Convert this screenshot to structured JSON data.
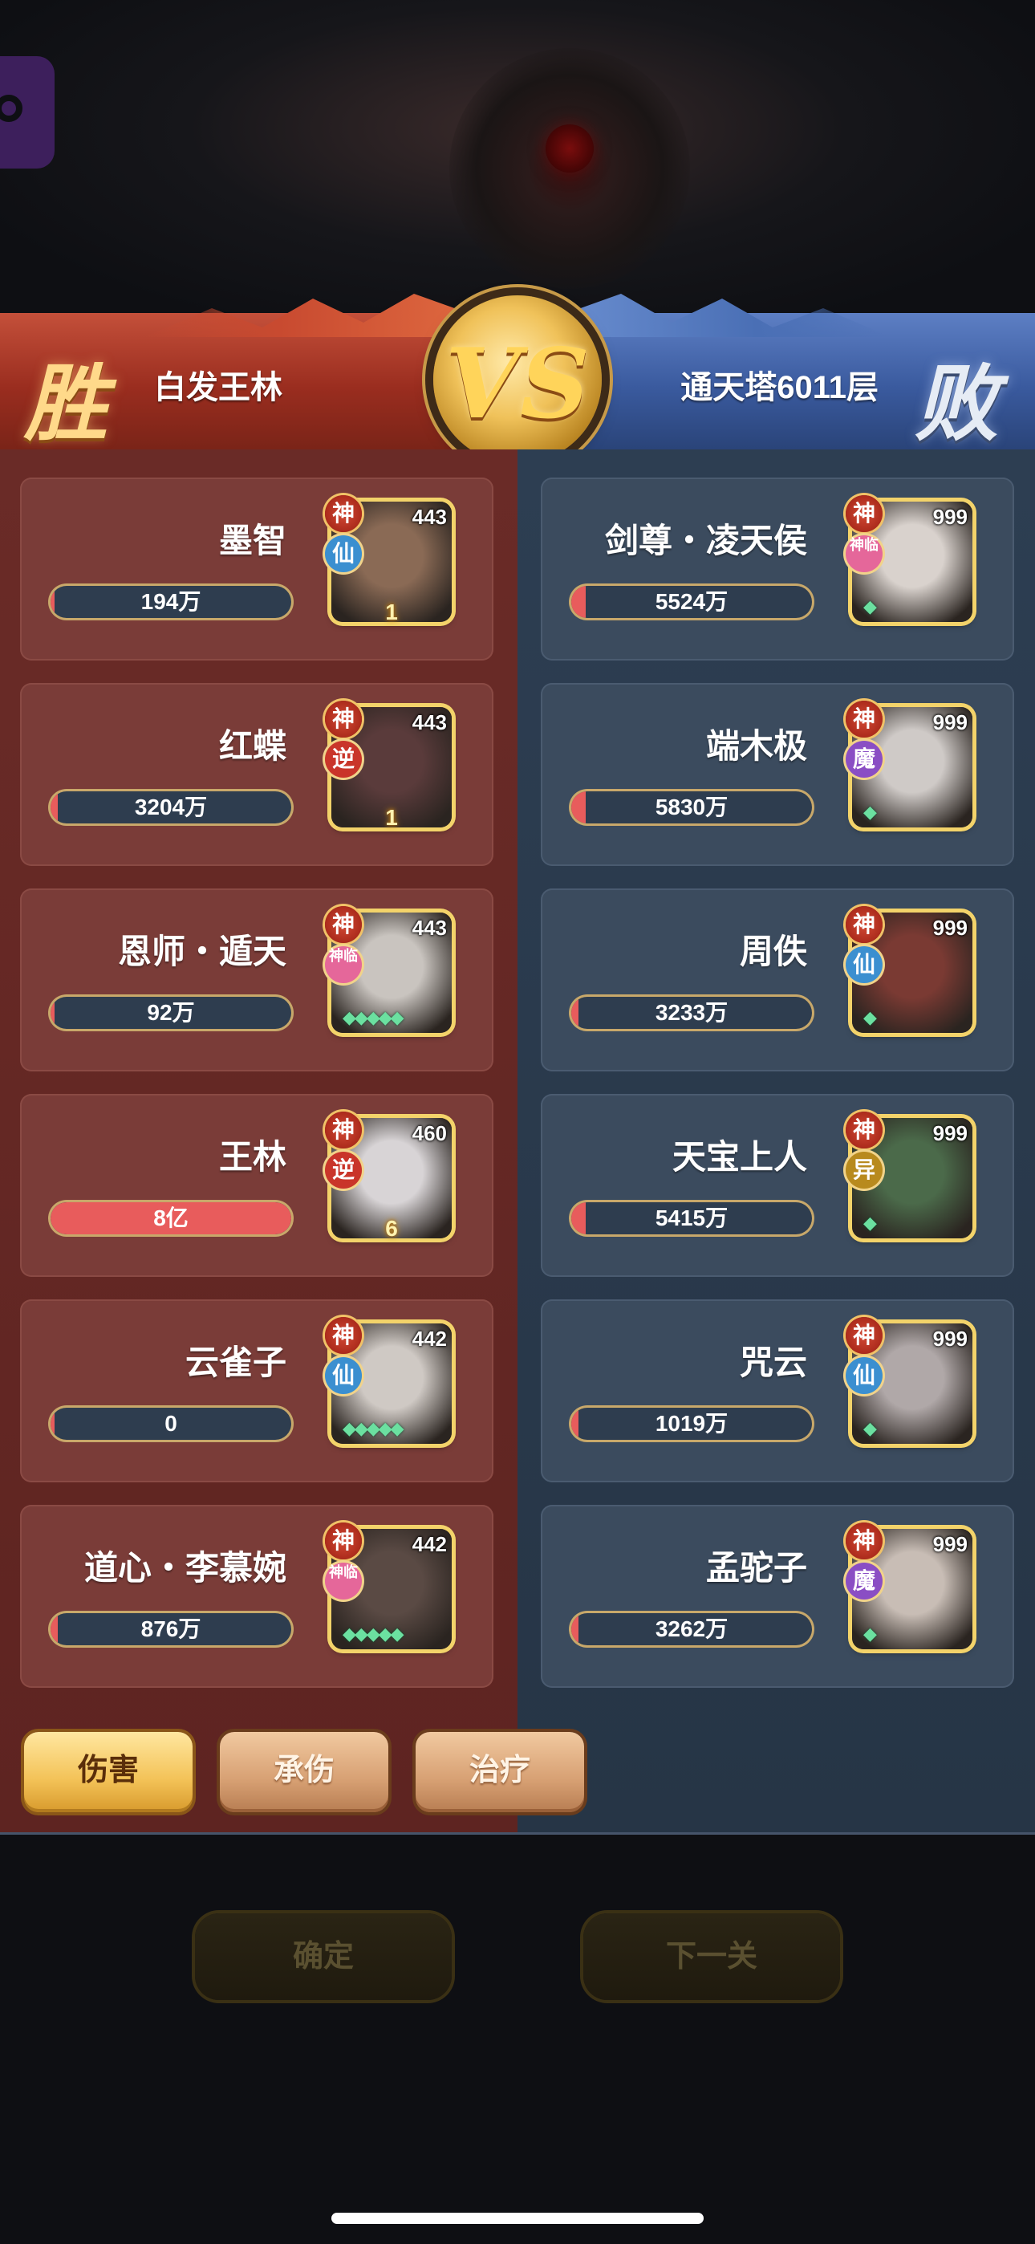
{
  "header": {
    "win_badge": "胜",
    "lose_badge": "败",
    "vs_label": "VS",
    "left_player": "白发王林",
    "right_player": "通天塔6011层"
  },
  "left_team": [
    {
      "name": "墨智",
      "value": "194万",
      "level": "443",
      "grade": "神",
      "faction": "仙",
      "fill_pct": 0,
      "extra": "1"
    },
    {
      "name": "红蝶",
      "value": "3204万",
      "level": "443",
      "grade": "神",
      "faction": "逆",
      "fill_pct": 3,
      "extra": "1"
    },
    {
      "name": "恩师・遁天",
      "value": "92万",
      "level": "443",
      "grade": "神",
      "faction": "神临",
      "fill_pct": 0,
      "extra": ""
    },
    {
      "name": "王林",
      "value": "8亿",
      "level": "460",
      "grade": "神",
      "faction": "逆",
      "fill_pct": 100,
      "extra": "6"
    },
    {
      "name": "云雀子",
      "value": "0",
      "level": "442",
      "grade": "神",
      "faction": "仙",
      "fill_pct": 0,
      "extra": ""
    },
    {
      "name": "道心・李慕婉",
      "value": "876万",
      "level": "442",
      "grade": "神",
      "faction": "神临",
      "fill_pct": 1,
      "extra": ""
    }
  ],
  "right_team": [
    {
      "name": "剑尊・凌天侯",
      "value": "5524万",
      "level": "999",
      "grade": "神",
      "faction": "神临",
      "fill_pct": 6
    },
    {
      "name": "端木极",
      "value": "5830万",
      "level": "999",
      "grade": "神",
      "faction": "魔",
      "fill_pct": 6
    },
    {
      "name": "周佚",
      "value": "3233万",
      "level": "999",
      "grade": "神",
      "faction": "仙",
      "fill_pct": 3
    },
    {
      "name": "天宝上人",
      "value": "5415万",
      "level": "999",
      "grade": "神",
      "faction": "异",
      "fill_pct": 6
    },
    {
      "name": "咒云",
      "value": "1019万",
      "level": "999",
      "grade": "神",
      "faction": "仙",
      "fill_pct": 1
    },
    {
      "name": "孟驼子",
      "value": "3262万",
      "level": "999",
      "grade": "神",
      "faction": "魔",
      "fill_pct": 3
    }
  ],
  "tabs": [
    "伤害",
    "承伤",
    "治疗"
  ],
  "active_tab": "伤害",
  "buttons": {
    "confirm": "确定",
    "next": "下一关"
  },
  "colors": {
    "win_red": "#9a2d1f",
    "lose_blue": "#3a5a9e",
    "bar_fill": "#e85c5c",
    "gold": "#f3c257"
  }
}
